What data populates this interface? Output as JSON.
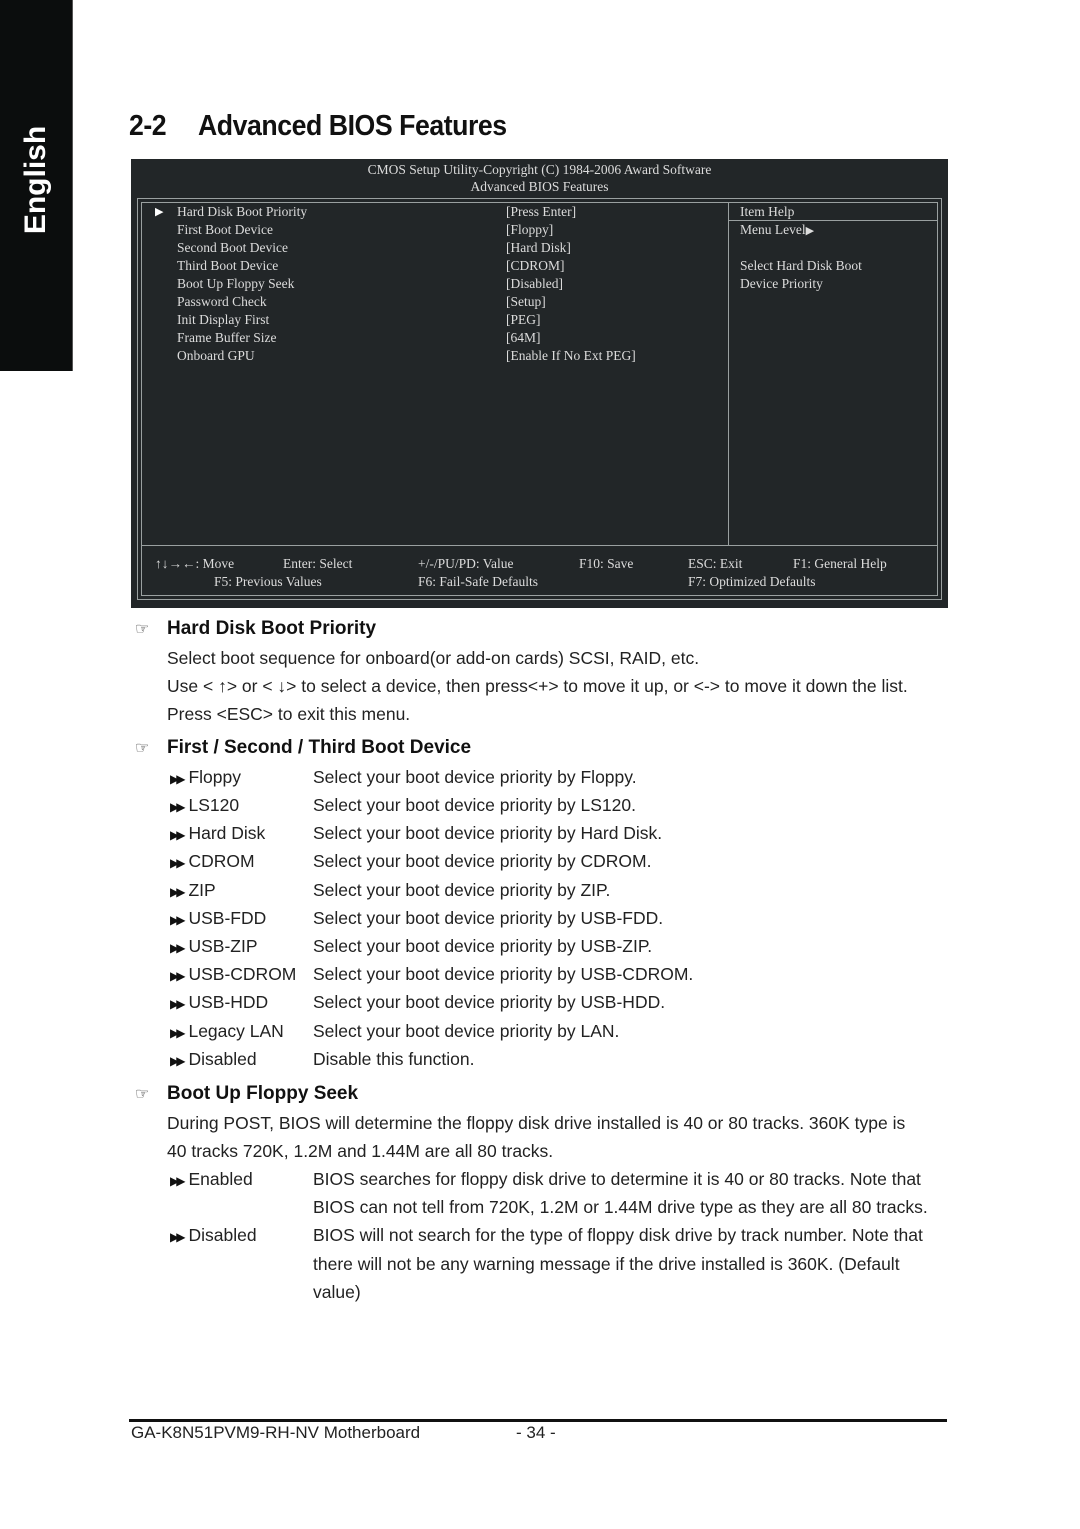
{
  "side_tab": {
    "label": "English"
  },
  "heading": {
    "number": "2-2",
    "title": "Advanced BIOS Features"
  },
  "bios": {
    "header_line1": "CMOS Setup Utility-Copyright (C) 1984-2006 Award Software",
    "header_line2": "Advanced BIOS Features",
    "items": [
      {
        "label": "Hard Disk Boot Priority",
        "value": "[Press Enter]",
        "submenu": true
      },
      {
        "label": "First Boot Device",
        "value": "[Floppy]"
      },
      {
        "label": "Second Boot Device",
        "value": "[Hard Disk]"
      },
      {
        "label": "Third Boot Device",
        "value": "[CDROM]"
      },
      {
        "label": "Boot Up Floppy Seek",
        "value": "[Disabled]"
      },
      {
        "label": "Password Check",
        "value": "[Setup]"
      },
      {
        "label": "Init Display First",
        "value": "[PEG]"
      },
      {
        "label": "Frame Buffer Size",
        "value": "[64M]"
      },
      {
        "label": "Onboard GPU",
        "value": "[Enable If No Ext PEG]"
      }
    ],
    "help": {
      "title": "Item Help",
      "menu_level": "Menu Level",
      "line1": "Select Hard Disk Boot",
      "line2": "Device Priority"
    },
    "footer": {
      "move": "↑↓→←: Move",
      "enter": "Enter: Select",
      "value": "+/-/PU/PD: Value",
      "save": "F10: Save",
      "exit": "ESC: Exit",
      "help": "F1: General Help",
      "prev": "F5: Previous Values",
      "failsafe": "F6: Fail-Safe Defaults",
      "optimized": "F7: Optimized Defaults"
    }
  },
  "sections": {
    "hdd": {
      "title": "Hard Disk Boot Priority",
      "lines": [
        "Select boot sequence for onboard(or add-on cards) SCSI, RAID, etc.",
        "Use < ↑> or < ↓> to select a device, then press<+> to move it up, or <-> to move it down the list.",
        "Press <ESC> to exit this menu."
      ]
    },
    "boot_device": {
      "title": "First / Second / Third Boot Device",
      "options": [
        {
          "name": "Floppy",
          "desc": "Select your boot device priority by Floppy."
        },
        {
          "name": "LS120",
          "desc": "Select your boot device priority by LS120."
        },
        {
          "name": "Hard Disk",
          "desc": "Select your boot device priority by Hard Disk."
        },
        {
          "name": "CDROM",
          "desc": "Select your boot device priority by CDROM."
        },
        {
          "name": "ZIP",
          "desc": "Select your boot device priority by ZIP."
        },
        {
          "name": "USB-FDD",
          "desc": "Select your boot device priority by USB-FDD."
        },
        {
          "name": "USB-ZIP",
          "desc": "Select your boot device priority by USB-ZIP."
        },
        {
          "name": "USB-CDROM",
          "desc": "Select your boot device priority by USB-CDROM."
        },
        {
          "name": "USB-HDD",
          "desc": "Select your boot device priority by USB-HDD."
        },
        {
          "name": "Legacy LAN",
          "desc": "Select your boot device priority by LAN."
        },
        {
          "name": "Disabled",
          "desc": "Disable this function."
        }
      ]
    },
    "floppy_seek": {
      "title": "Boot Up Floppy Seek",
      "lines": [
        "During POST, BIOS will determine the floppy disk drive installed is 40 or 80 tracks. 360K type is",
        "40 tracks 720K, 1.2M and 1.44M are all 80 tracks."
      ],
      "options": [
        {
          "name": "Enabled",
          "desc": [
            "BIOS searches for floppy disk drive to determine it is 40 or 80 tracks. Note that",
            "BIOS can not tell from 720K, 1.2M or 1.44M drive type as they are all 80 tracks."
          ]
        },
        {
          "name": "Disabled",
          "desc": [
            "BIOS will not search for the type of floppy disk drive by track number. Note that",
            "there will not be any warning message if the drive installed is 360K. (Default",
            "value)"
          ]
        }
      ]
    }
  },
  "footer": {
    "model": "GA-K8N51PVM9-RH-NV Motherboard",
    "page": "- 34 -"
  }
}
